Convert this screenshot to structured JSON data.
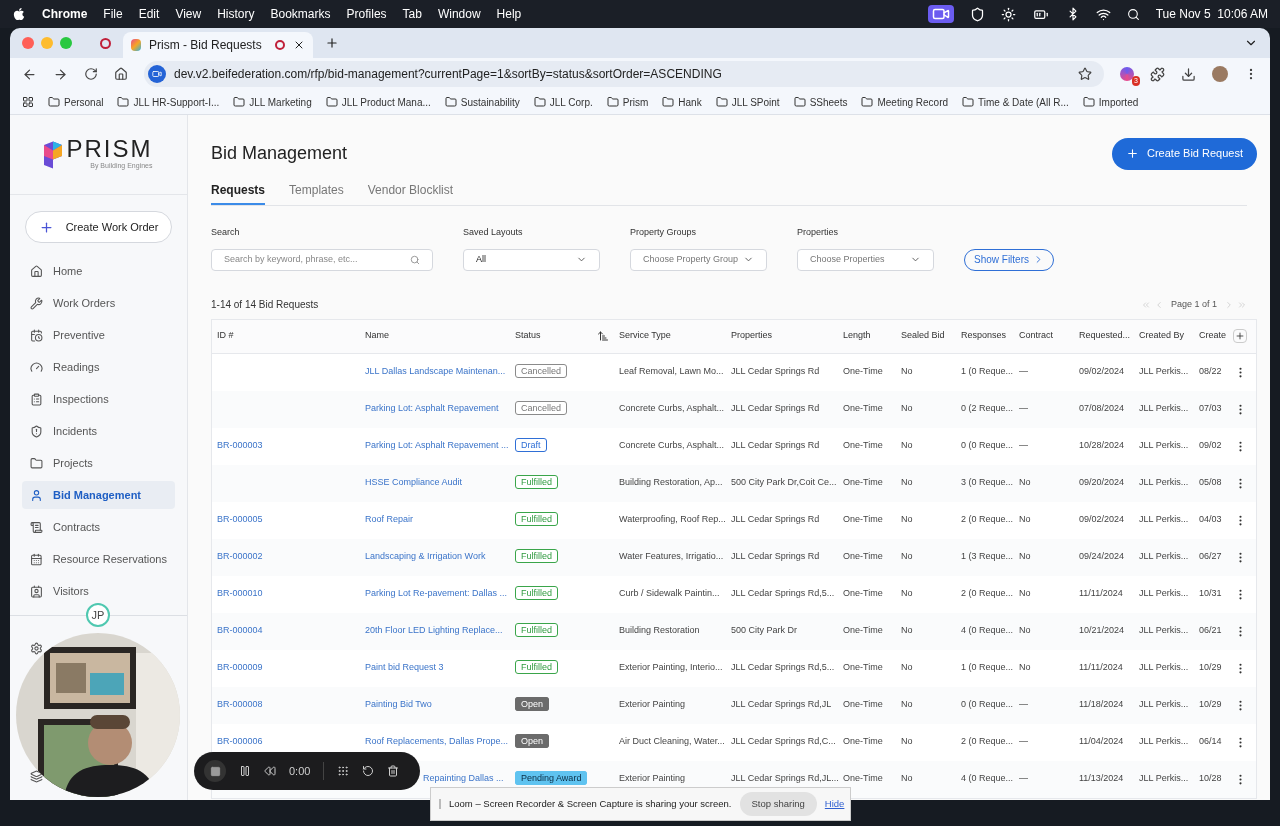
{
  "menubar": {
    "app": "Chrome",
    "menus": [
      "File",
      "Edit",
      "View",
      "History",
      "Bookmarks",
      "Profiles",
      "Tab",
      "Window",
      "Help"
    ],
    "clock": "Tue Nov 5  10:06 AM"
  },
  "browser": {
    "tabs": [
      {
        "title": "Prism - Bid Requests",
        "selected": true
      }
    ],
    "url": "dev.v2.beifederation.com/rfp/bid-management?currentPage=1&sortBy=status&sortOrder=ASCENDING",
    "extension_badge": "3",
    "bookmarks": [
      "Personal",
      "JLL HR-Support-I...",
      "JLL Marketing",
      "JLL Product Mana...",
      "Sustainability",
      "JLL Corp.",
      "Prism",
      "Hank",
      "JLL SPoint",
      "SSheets",
      "Meeting Record",
      "Time & Date (All R...",
      "Imported"
    ]
  },
  "sidebar": {
    "logo": "PRISM",
    "logo_sub": "By Building Engines",
    "create_button": "Create Work Order",
    "avatar": "JP",
    "items": [
      {
        "label": "Home",
        "selected": false
      },
      {
        "label": "Work Orders",
        "selected": false
      },
      {
        "label": "Preventive",
        "selected": false
      },
      {
        "label": "Readings",
        "selected": false
      },
      {
        "label": "Inspections",
        "selected": false
      },
      {
        "label": "Incidents",
        "selected": false
      },
      {
        "label": "Projects",
        "selected": false
      },
      {
        "label": "Bid Management",
        "selected": true
      },
      {
        "label": "Contracts",
        "selected": false
      },
      {
        "label": "Resource Reservations",
        "selected": false
      },
      {
        "label": "Visitors",
        "selected": false
      }
    ]
  },
  "page": {
    "title": "Bid Management",
    "create_button": "Create Bid Request",
    "tabs": [
      {
        "label": "Requests",
        "selected": true
      },
      {
        "label": "Templates",
        "selected": false
      },
      {
        "label": "Vendor Blocklist",
        "selected": false
      }
    ],
    "filters": [
      {
        "kind": "search",
        "label": "Search",
        "placeholder": "Search by keyword, phrase, etc..."
      },
      {
        "kind": "select",
        "label": "Saved Layouts",
        "value": "All"
      },
      {
        "kind": "select",
        "label": "Property Groups",
        "placeholder": "Choose Property Group"
      },
      {
        "kind": "select",
        "label": "Properties",
        "placeholder": "Choose Properties"
      }
    ],
    "show_filters": "Show Filters",
    "count": "1-14 of 14 Bid Requests",
    "pagination": "Page 1 of 1"
  },
  "table": {
    "columns": [
      "ID #",
      "Name",
      "Status",
      "Service Type",
      "Properties",
      "Length",
      "Sealed Bid",
      "Responses",
      "Contract",
      "Requested...",
      "Created By",
      "Create"
    ],
    "rows": [
      {
        "id": "",
        "name": "JLL Dallas Landscape Maintenan...",
        "status": {
          "label": "Cancelled",
          "kind": "cancelled"
        },
        "service": "Leaf Removal, Lawn Mo...",
        "properties": "JLL Cedar Springs Rd",
        "length": "One-Time",
        "sealed": "No",
        "responses": "1 (0 Reque...",
        "contract": "—",
        "requested": "09/02/2024",
        "created_by": "JLL Perkis...",
        "created": "08/22"
      },
      {
        "id": "",
        "name": "Parking Lot: Asphalt Repavement",
        "status": {
          "label": "Cancelled",
          "kind": "cancelled"
        },
        "service": "Concrete Curbs, Asphalt...",
        "properties": "JLL Cedar Springs Rd",
        "length": "One-Time",
        "sealed": "No",
        "responses": "0 (2 Reque...",
        "contract": "—",
        "requested": "07/08/2024",
        "created_by": "JLL Perkis...",
        "created": "07/03"
      },
      {
        "id": "BR-000003",
        "name": "Parking Lot: Asphalt Repavement ...",
        "status": {
          "label": "Draft",
          "kind": "draft"
        },
        "service": "Concrete Curbs, Asphalt...",
        "properties": "JLL Cedar Springs Rd",
        "length": "One-Time",
        "sealed": "No",
        "responses": "0 (0 Reque...",
        "contract": "—",
        "requested": "10/28/2024",
        "created_by": "JLL Perkis...",
        "created": "09/02"
      },
      {
        "id": "",
        "name": "HSSE Compliance Audit",
        "status": {
          "label": "Fulfilled",
          "kind": "fulfilled"
        },
        "service": "Building Restoration, Ap...",
        "properties": "500 City Park Dr,Coit Ce...",
        "length": "One-Time",
        "sealed": "No",
        "responses": "3 (0 Reque...",
        "contract": "No",
        "requested": "09/20/2024",
        "created_by": "JLL Perkis...",
        "created": "05/08"
      },
      {
        "id": "BR-000005",
        "name": "Roof Repair",
        "status": {
          "label": "Fulfilled",
          "kind": "fulfilled"
        },
        "service": "Waterproofing, Roof Rep...",
        "properties": "JLL Cedar Springs Rd",
        "length": "One-Time",
        "sealed": "No",
        "responses": "2 (0 Reque...",
        "contract": "No",
        "requested": "09/02/2024",
        "created_by": "JLL Perkis...",
        "created": "04/03"
      },
      {
        "id": "BR-000002",
        "name": "Landscaping & Irrigation Work",
        "status": {
          "label": "Fulfilled",
          "kind": "fulfilled"
        },
        "service": "Water Features, Irrigatio...",
        "properties": "JLL Cedar Springs Rd",
        "length": "One-Time",
        "sealed": "No",
        "responses": "1 (3 Reque...",
        "contract": "No",
        "requested": "09/24/2024",
        "created_by": "JLL Perkis...",
        "created": "06/27"
      },
      {
        "id": "BR-000010",
        "name": "Parking Lot Re-pavement: Dallas ...",
        "status": {
          "label": "Fulfilled",
          "kind": "fulfilled"
        },
        "service": "Curb / Sidewalk Paintin...",
        "properties": "JLL Cedar Springs Rd,5...",
        "length": "One-Time",
        "sealed": "No",
        "responses": "2 (0 Reque...",
        "contract": "No",
        "requested": "11/11/2024",
        "created_by": "JLL Perkis...",
        "created": "10/31"
      },
      {
        "id": "BR-000004",
        "name": "20th Floor LED Lighting Replace...",
        "status": {
          "label": "Fulfilled",
          "kind": "fulfilled"
        },
        "service": "Building Restoration",
        "properties": "500 City Park Dr",
        "length": "One-Time",
        "sealed": "No",
        "responses": "4 (0 Reque...",
        "contract": "No",
        "requested": "10/21/2024",
        "created_by": "JLL Perkis...",
        "created": "06/21"
      },
      {
        "id": "BR-000009",
        "name": "Paint bid Request 3",
        "status": {
          "label": "Fulfilled",
          "kind": "fulfilled"
        },
        "service": "Exterior Painting, Interio...",
        "properties": "JLL Cedar Springs Rd,5...",
        "length": "One-Time",
        "sealed": "No",
        "responses": "1 (0 Reque...",
        "contract": "No",
        "requested": "11/11/2024",
        "created_by": "JLL Perkis...",
        "created": "10/29"
      },
      {
        "id": "BR-000008",
        "name": "Painting Bid Two",
        "status": {
          "label": "Open",
          "kind": "open"
        },
        "service": "Exterior Painting",
        "properties": "JLL Cedar Springs Rd,JL",
        "length": "One-Time",
        "sealed": "No",
        "responses": "0 (0 Reque...",
        "contract": "—",
        "requested": "11/18/2024",
        "created_by": "JLL Perkis...",
        "created": "10/29"
      },
      {
        "id": "BR-000006",
        "name": "Roof Replacements, Dallas Prope...",
        "status": {
          "label": "Open",
          "kind": "open"
        },
        "service": "Air Duct Cleaning, Water...",
        "properties": "JLL Cedar Springs Rd,C...",
        "length": "One-Time",
        "sealed": "No",
        "responses": "2 (0 Reque...",
        "contract": "—",
        "requested": "11/04/2024",
        "created_by": "JLL Perkis...",
        "created": "06/14"
      },
      {
        "id": "",
        "name": "Repainting Dallas ...",
        "partially_hidden": true,
        "status": {
          "label": "Pending Award",
          "kind": "pending"
        },
        "service": "Exterior Painting",
        "properties": "JLL Cedar Springs Rd,JL...",
        "length": "One-Time",
        "sealed": "No",
        "responses": "4 (0 Reque...",
        "contract": "—",
        "requested": "11/13/2024",
        "created_by": "JLL Perkis...",
        "created": "10/28"
      }
    ]
  },
  "recorder": {
    "time": "0:00"
  },
  "share_banner": {
    "message": "Loom – Screen Recorder & Screen Capture is sharing your screen.",
    "stop": "Stop sharing",
    "hide": "Hide"
  }
}
